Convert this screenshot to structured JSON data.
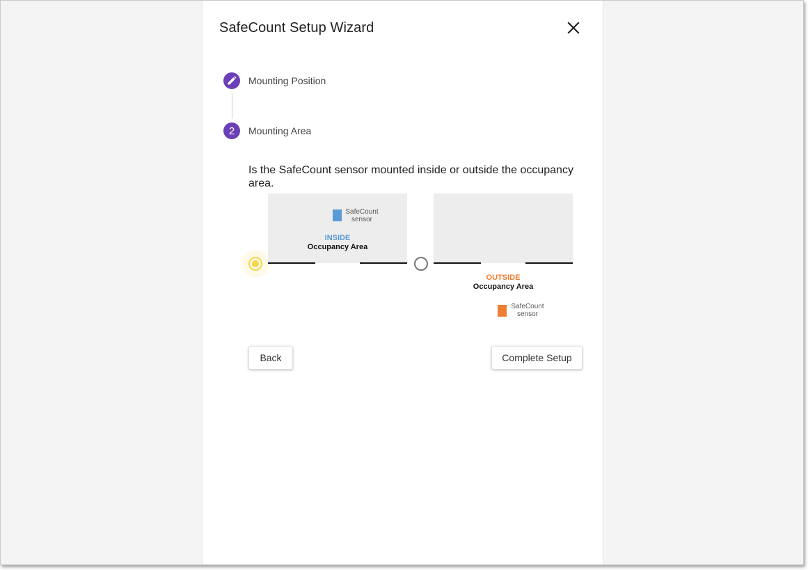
{
  "dialog": {
    "title": "SafeCount Setup Wizard"
  },
  "steps": [
    {
      "label": "Mounting Position",
      "state": "edit",
      "icon": "pencil-icon"
    },
    {
      "label": "Mounting Area",
      "number": "2",
      "state": "active"
    }
  ],
  "question": "Is the SafeCount sensor mounted inside or outside the occupancy area.",
  "options": {
    "inside": {
      "word": "INSIDE",
      "sub": "Occupancy Area",
      "sensor_text": "SafeCount sensor",
      "selected": true
    },
    "outside": {
      "word": "OUTSIDE",
      "sub": "Occupancy Area",
      "sensor_text": "SafeCount sensor",
      "selected": false
    }
  },
  "buttons": {
    "back": "Back",
    "complete": "Complete Setup"
  },
  "colors": {
    "accent": "#6b3fb5",
    "radio_selected": "#f9d548",
    "inside": "#5b9bd5",
    "outside": "#ed7d31"
  }
}
